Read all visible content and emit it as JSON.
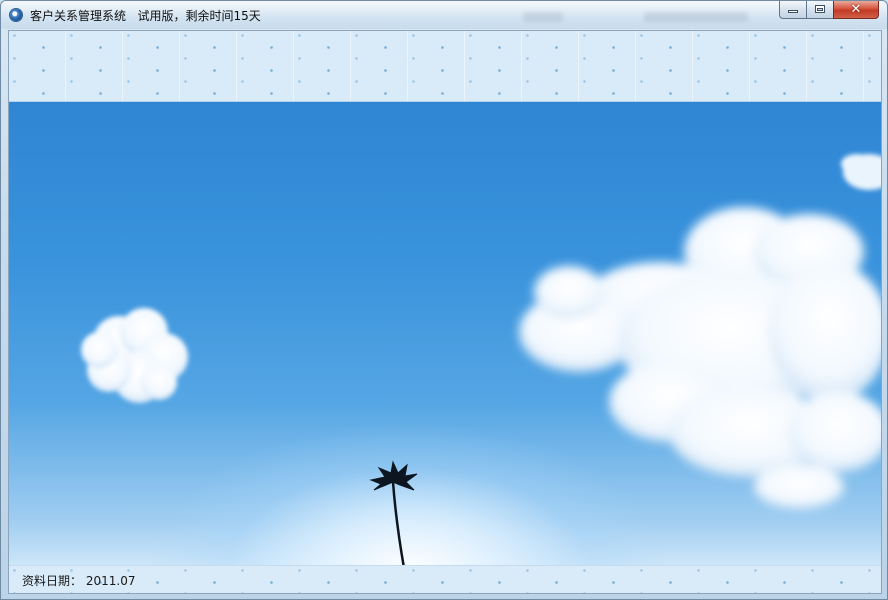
{
  "window": {
    "title": "客户关系管理系统   试用版，剩余时间15天",
    "icon": "app-globe-icon",
    "buttons": {
      "minimize_icon": "minimize-icon",
      "maximize_icon": "maximize-icon",
      "close_glyph": "✕"
    }
  },
  "statusbar": {
    "date_label": "资料日期：",
    "date_value": "2011.07"
  },
  "colors": {
    "sky_top": "#2f86d4",
    "sky_bottom": "#cfe6f8",
    "band": "#d9ebf8",
    "close_button": "#c23a24"
  }
}
